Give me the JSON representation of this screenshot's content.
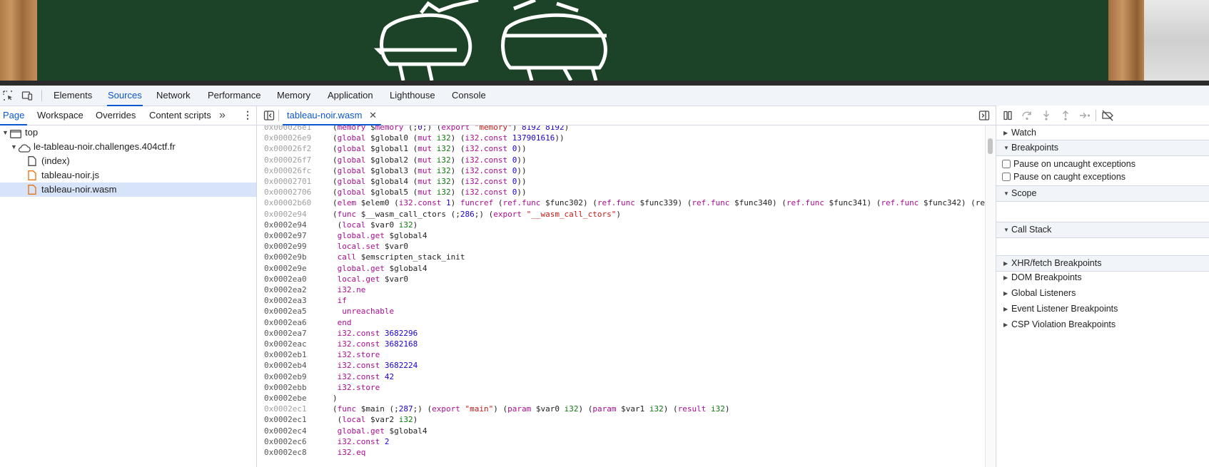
{
  "devtools": {
    "main_tabs": [
      "Elements",
      "Sources",
      "Network",
      "Performance",
      "Memory",
      "Application",
      "Lighthouse",
      "Console"
    ],
    "active_main_tab": "Sources"
  },
  "navigator": {
    "tabs": [
      "Page",
      "Workspace",
      "Overrides",
      "Content scripts"
    ],
    "more_icon": "chevron-double-right-icon",
    "tree": {
      "top": "top",
      "domain": "le-tableau-noir.challenges.404ctf.fr",
      "files": [
        "(index)",
        "tableau-noir.js",
        "tableau-noir.wasm"
      ],
      "selected": "tableau-noir.wasm"
    }
  },
  "editor": {
    "open_tab": "tableau-noir.wasm",
    "lines": [
      {
        "addr": "0x000026e1",
        "code": "(memory $memory (;0;) (export \"memory\") 8192 8192)"
      },
      {
        "addr": "0x000026e9",
        "code": "(global $global0 (mut i32) (i32.const 137901616))"
      },
      {
        "addr": "0x000026f2",
        "code": "(global $global1 (mut i32) (i32.const 0))"
      },
      {
        "addr": "0x000026f7",
        "code": "(global $global2 (mut i32) (i32.const 0))"
      },
      {
        "addr": "0x000026fc",
        "code": "(global $global3 (mut i32) (i32.const 0))"
      },
      {
        "addr": "0x00002701",
        "code": "(global $global4 (mut i32) (i32.const 0))"
      },
      {
        "addr": "0x00002706",
        "code": "(global $global5 (mut i32) (i32.const 0))"
      },
      {
        "addr": "0x00002b60",
        "code": "(elem $elem0 (i32.const 1) funcref (ref.func $func302) (ref.func $func339) (ref.func $func340) (ref.func $func341) (ref.func $func342) (ref"
      },
      {
        "addr": "0x0002e94",
        "code": "(func $__wasm_call_ctors (;286;) (export \"__wasm_call_ctors\")"
      },
      {
        "addr": "0x0002e94",
        "code": " (local $var0 i32)"
      },
      {
        "addr": "0x0002e97",
        "code": " global.get $global4"
      },
      {
        "addr": "0x0002e99",
        "code": " local.set $var0"
      },
      {
        "addr": "0x0002e9b",
        "code": " call $emscripten_stack_init"
      },
      {
        "addr": "0x0002e9e",
        "code": " global.get $global4"
      },
      {
        "addr": "0x0002ea0",
        "code": " local.get $var0"
      },
      {
        "addr": "0x0002ea2",
        "code": " i32.ne"
      },
      {
        "addr": "0x0002ea3",
        "code": " if"
      },
      {
        "addr": "0x0002ea5",
        "code": "  unreachable"
      },
      {
        "addr": "0x0002ea6",
        "code": " end"
      },
      {
        "addr": "0x0002ea7",
        "code": " i32.const 3682296"
      },
      {
        "addr": "0x0002eac",
        "code": " i32.const 3682168"
      },
      {
        "addr": "0x0002eb1",
        "code": " i32.store"
      },
      {
        "addr": "0x0002eb4",
        "code": " i32.const 3682224"
      },
      {
        "addr": "0x0002eb9",
        "code": " i32.const 42"
      },
      {
        "addr": "0x0002ebb",
        "code": " i32.store"
      },
      {
        "addr": "0x0002ebe",
        "code": ")"
      },
      {
        "addr": "0x0002ec1",
        "code": "(func $main (;287;) (export \"main\") (param $var0 i32) (param $var1 i32) (result i32)"
      },
      {
        "addr": "0x0002ec1",
        "code": " (local $var2 i32)"
      },
      {
        "addr": "0x0002ec4",
        "code": " global.get $global4"
      },
      {
        "addr": "0x0002ec6",
        "code": " i32.const 2"
      },
      {
        "addr": "0x0002ec8",
        "code": " i32.eq"
      }
    ]
  },
  "debugger": {
    "toolbar_icons": [
      "pause-icon",
      "step-over-icon",
      "step-into-icon",
      "step-out-icon",
      "step-icon",
      "deactivate-breakpoints-icon"
    ],
    "panes": {
      "watch": "Watch",
      "breakpoints": "Breakpoints",
      "pause_uncaught": "Pause on uncaught exceptions",
      "pause_caught": "Pause on caught exceptions",
      "scope": "Scope",
      "call_stack": "Call Stack",
      "xhr": "XHR/fetch Breakpoints",
      "dom": "DOM Breakpoints",
      "global": "Global Listeners",
      "event": "Event Listener Breakpoints",
      "csp": "CSP Violation Breakpoints"
    }
  }
}
